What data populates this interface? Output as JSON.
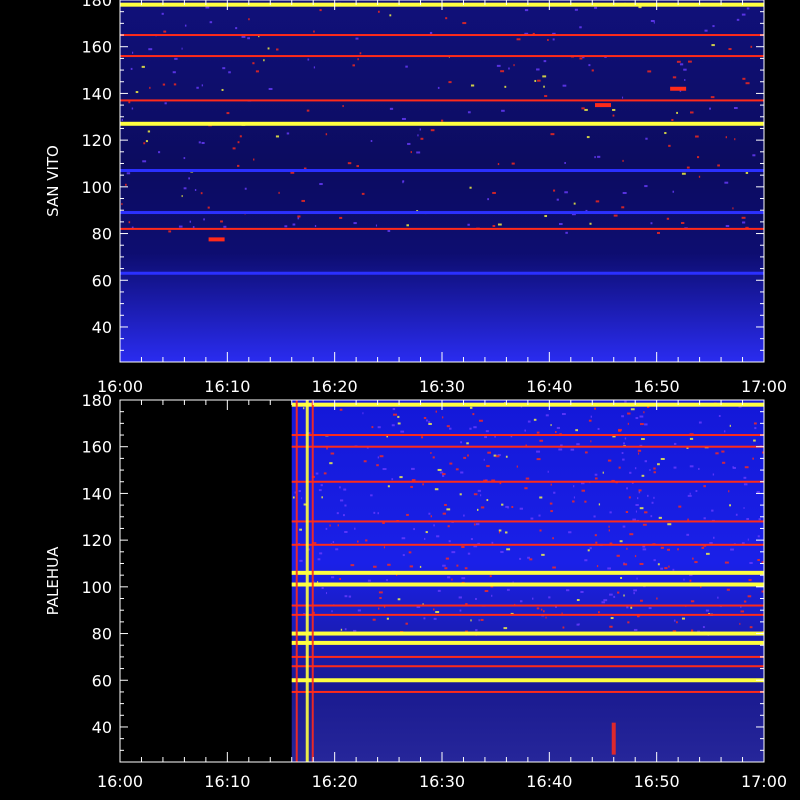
{
  "chart_data": [
    {
      "type": "heatmap",
      "ylabel": "SAN VITO",
      "xlabel": "",
      "xticks": [
        "16:00",
        "16:10",
        "16:20",
        "16:30",
        "16:40",
        "16:50",
        "17:00"
      ],
      "xlim": [
        "16:00",
        "17:00"
      ],
      "yticks": [
        40,
        60,
        80,
        100,
        120,
        140,
        160,
        180
      ],
      "ylim": [
        25,
        180
      ],
      "colors": {
        "background": "#000000",
        "low": "#0a0a5a",
        "mid": "#2b30ff",
        "high": "#ff2a1a",
        "peak": "#ffff40",
        "frame": "#ffffff"
      },
      "bands": [
        {
          "freq": 178,
          "level": "peak"
        },
        {
          "freq": 165,
          "level": "high"
        },
        {
          "freq": 156,
          "level": "high"
        },
        {
          "freq": 137,
          "level": "high"
        },
        {
          "freq": 127,
          "level": "peak"
        },
        {
          "freq": 107,
          "level": "mid"
        },
        {
          "freq": 89,
          "level": "mid"
        },
        {
          "freq": 82,
          "level": "high"
        },
        {
          "freq": 63,
          "level": "mid"
        }
      ],
      "bursts": [
        {
          "time": "16:09",
          "freq": 77.5,
          "level": "high"
        },
        {
          "time": "16:52",
          "freq": 142,
          "level": "high"
        },
        {
          "time": "16:45",
          "freq": 135,
          "level": "high"
        }
      ],
      "data_gap": null
    },
    {
      "type": "heatmap",
      "ylabel": "PALEHUA",
      "xlabel": "",
      "xticks": [
        "16:00",
        "16:10",
        "16:20",
        "16:30",
        "16:40",
        "16:50",
        "17:00"
      ],
      "xlim": [
        "16:00",
        "17:00"
      ],
      "yticks": [
        40,
        60,
        80,
        100,
        120,
        140,
        160,
        180
      ],
      "ylim": [
        25,
        180
      ],
      "colors": {
        "background": "#000000",
        "low": "#0a0a5a",
        "mid": "#2b30ff",
        "high": "#ff2a1a",
        "peak": "#ffff40",
        "frame": "#ffffff"
      },
      "bands": [
        {
          "freq": 178,
          "level": "peak"
        },
        {
          "freq": 165,
          "level": "high"
        },
        {
          "freq": 160,
          "level": "high"
        },
        {
          "freq": 145,
          "level": "high"
        },
        {
          "freq": 128,
          "level": "high"
        },
        {
          "freq": 118,
          "level": "high"
        },
        {
          "freq": 106,
          "level": "peak"
        },
        {
          "freq": 101,
          "level": "peak"
        },
        {
          "freq": 92,
          "level": "high"
        },
        {
          "freq": 88,
          "level": "high"
        },
        {
          "freq": 80,
          "level": "peak"
        },
        {
          "freq": 76,
          "level": "peak"
        },
        {
          "freq": 70,
          "level": "high"
        },
        {
          "freq": 66,
          "level": "high"
        },
        {
          "freq": 60,
          "level": "peak"
        },
        {
          "freq": 55,
          "level": "high"
        }
      ],
      "bursts": [
        {
          "time": "16:46",
          "freq": 35,
          "level": "high"
        }
      ],
      "data_gap": {
        "start": "16:00",
        "end": "16:16"
      }
    }
  ]
}
